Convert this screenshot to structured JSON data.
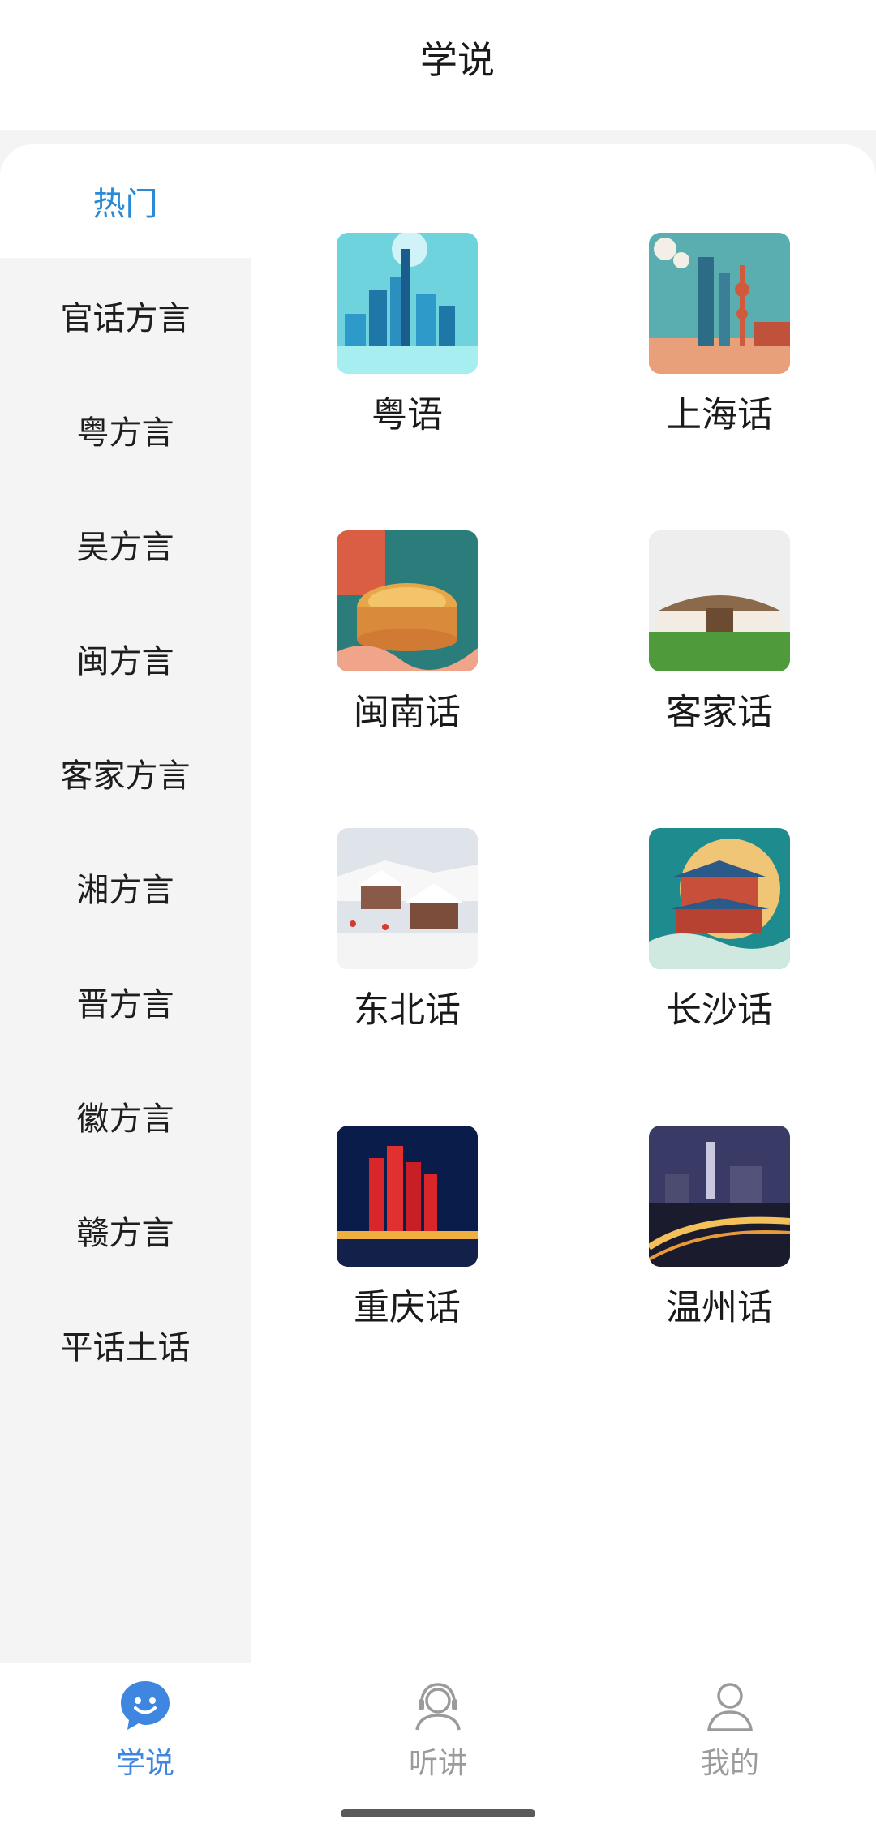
{
  "header": {
    "title": "学说"
  },
  "sidebar": {
    "items": [
      {
        "label": "热门",
        "active": true
      },
      {
        "label": "官话方言"
      },
      {
        "label": "粤方言"
      },
      {
        "label": "吴方言"
      },
      {
        "label": "闽方言"
      },
      {
        "label": "客家方言"
      },
      {
        "label": "湘方言"
      },
      {
        "label": "晋方言"
      },
      {
        "label": "徽方言"
      },
      {
        "label": "赣方言"
      },
      {
        "label": "平话土话"
      }
    ]
  },
  "grid": {
    "items": [
      {
        "label": "粤语",
        "icon": "guangzhou-skyline-image"
      },
      {
        "label": "上海话",
        "icon": "shanghai-skyline-image"
      },
      {
        "label": "闽南话",
        "icon": "tulou-illustration-image"
      },
      {
        "label": "客家话",
        "icon": "hakka-tulou-image"
      },
      {
        "label": "东北话",
        "icon": "snow-village-image"
      },
      {
        "label": "长沙话",
        "icon": "changsha-pavilion-image"
      },
      {
        "label": "重庆话",
        "icon": "chongqing-night-image"
      },
      {
        "label": "温州话",
        "icon": "wenzhou-night-image"
      }
    ]
  },
  "tabbar": {
    "items": [
      {
        "label": "学说",
        "icon": "chat-smile-icon",
        "active": true
      },
      {
        "label": "听讲",
        "icon": "headset-user-icon"
      },
      {
        "label": "我的",
        "icon": "user-profile-icon"
      }
    ]
  },
  "colors": {
    "accent": "#3e86e0",
    "sidebar_active": "#2a8ad6",
    "inactive": "#9b9b9b"
  }
}
